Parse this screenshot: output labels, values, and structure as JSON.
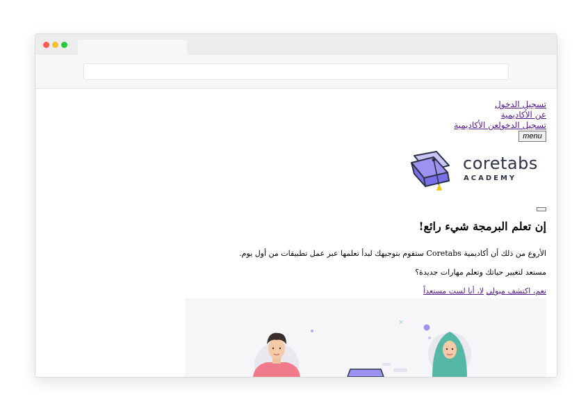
{
  "nav": {
    "login": "تسجيل الدخول",
    "about": "عن الأكاديمية",
    "login_inline": "تسجيل الدخول",
    "about_inline": "عن الأكاديمية",
    "menu_label": "menu"
  },
  "logo": {
    "name": "coretabs",
    "subtitle": "ACADEMY"
  },
  "hero": {
    "heading": "إن تعلم البرمجة شيء رائع!",
    "paragraph": "الأروع من ذلك أن أكاديمية Coretabs ستقوم بتوجيهك لبدأ تعلمها عبر عمل تطبيقات من أول يوم.",
    "question": "مستعد لتغيير حياتك وتعلم مهارات جديدة؟",
    "cta_yes": "نعم، اكتشف ميولي",
    "cta_no": "لا، أنا لست مستعداً"
  },
  "colors": {
    "link": "#551a8b",
    "brand_dark": "#2b3245",
    "brand_purple": "#7b6fe8",
    "accent_yellow": "#f5c518"
  }
}
